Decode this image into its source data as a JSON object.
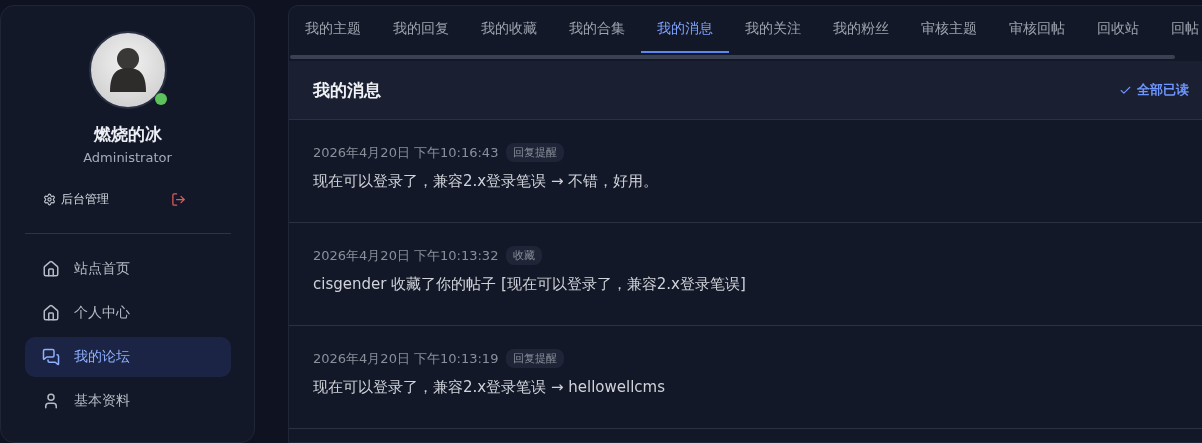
{
  "profile": {
    "name": "燃烧的冰",
    "role": "Administrator",
    "online": true
  },
  "actions": {
    "admin": "后台管理",
    "logout": true
  },
  "nav": [
    {
      "label": "站点首页",
      "selected": false
    },
    {
      "label": "个人中心",
      "selected": false
    },
    {
      "label": "我的论坛",
      "selected": true
    },
    {
      "label": "基本资料",
      "selected": false
    }
  ],
  "tabs": [
    {
      "label": "我的主题",
      "selected": false
    },
    {
      "label": "我的回复",
      "selected": false
    },
    {
      "label": "我的收藏",
      "selected": false
    },
    {
      "label": "我的合集",
      "selected": false
    },
    {
      "label": "我的消息",
      "selected": true
    },
    {
      "label": "我的关注",
      "selected": false
    },
    {
      "label": "我的粉丝",
      "selected": false
    },
    {
      "label": "审核主题",
      "selected": false
    },
    {
      "label": "审核回帖",
      "selected": false
    },
    {
      "label": "回收站",
      "selected": false
    },
    {
      "label": "回帖",
      "selected": false
    }
  ],
  "panel": {
    "title": "我的消息",
    "mark_all": "全部已读"
  },
  "messages": [
    {
      "time": "2026年4月20日 下午10:16:43",
      "tag": "回复提醒",
      "text": "现在可以登录了，兼容2.x登录笔误 → 不错，好用。"
    },
    {
      "time": "2026年4月20日 下午10:13:32",
      "tag": "收藏",
      "text": "cisgender 收藏了你的帖子 [现在可以登录了，兼容2.x登录笔误]"
    },
    {
      "time": "2026年4月20日 下午10:13:19",
      "tag": "回复提醒",
      "text": "现在可以登录了，兼容2.x登录笔误 → hellowellcms"
    }
  ]
}
